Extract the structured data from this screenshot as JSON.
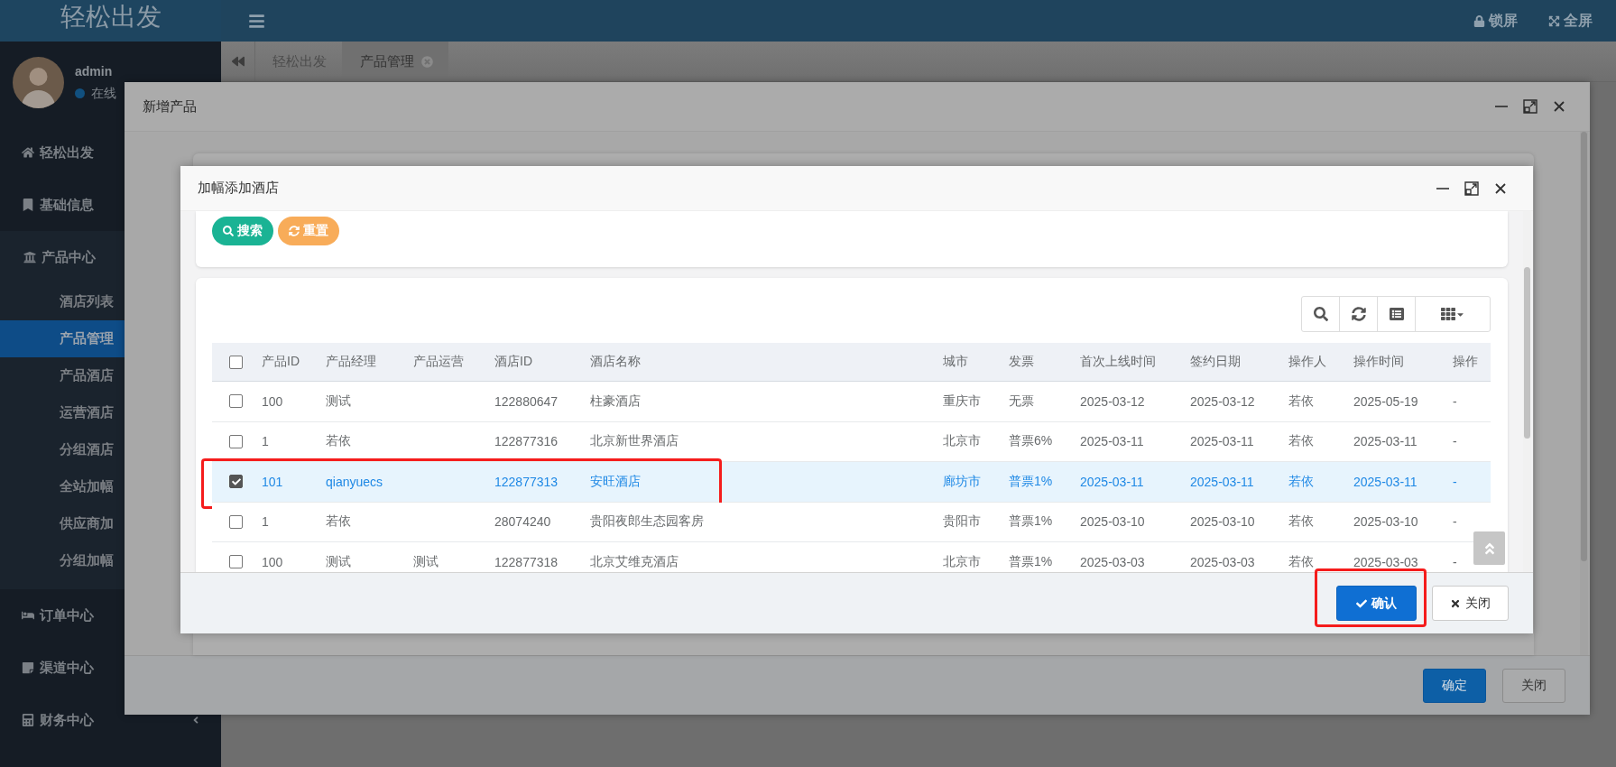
{
  "topbar": {
    "logo": "轻松出发",
    "actions": [
      {
        "kind": "lock",
        "label": "锁屏"
      },
      {
        "kind": "fullscreen",
        "label": "全屏"
      }
    ]
  },
  "user": {
    "name": "admin",
    "status": "在线"
  },
  "sidebar": {
    "items": [
      {
        "label": "轻松出发"
      },
      {
        "label": "基础信息"
      },
      {
        "label": "产品中心",
        "expanded": true,
        "children": [
          {
            "label": "酒店列表",
            "selected": false
          },
          {
            "label": "产品管理",
            "selected": true
          },
          {
            "label": "产品酒店",
            "selected": false
          },
          {
            "label": "运营酒店",
            "selected": false
          },
          {
            "label": "分组酒店",
            "selected": false
          },
          {
            "label": "全站加幅",
            "selected": false
          },
          {
            "label": "供应商加",
            "selected": false
          },
          {
            "label": "分组加幅",
            "selected": false
          }
        ]
      },
      {
        "label": "订单中心"
      },
      {
        "label": "渠道中心"
      },
      {
        "label": "财务中心",
        "expanded": false
      }
    ]
  },
  "tabs": [
    {
      "label": "轻松出发",
      "selected": false,
      "closable": false
    },
    {
      "label": "产品管理",
      "selected": true,
      "closable": true
    }
  ],
  "outer_dialog": {
    "title": "新增产品",
    "buttons": [
      {
        "kind": "primary",
        "label": "确定"
      },
      {
        "kind": "default",
        "label": "关闭"
      }
    ]
  },
  "inner_dialog": {
    "title": "加幅添加酒店",
    "search_buttons": [
      {
        "kind": "search",
        "label": "搜索"
      },
      {
        "kind": "reset",
        "label": "重置"
      }
    ],
    "toolbar": [
      {
        "kind": "search"
      },
      {
        "kind": "refresh"
      },
      {
        "kind": "list"
      },
      {
        "kind": "columns"
      }
    ],
    "table": {
      "all_checked": false,
      "columns": [
        "产品ID",
        "产品经理",
        "产品运营",
        "酒店ID",
        "酒店名称",
        "城市",
        "发票",
        "首次上线时间",
        "签约日期",
        "操作人",
        "操作时间",
        "操作"
      ],
      "rows": [
        {
          "selected": false,
          "highlighted": false,
          "cells": [
            "100",
            "测试",
            null,
            "122880647",
            "柱豪酒店",
            "重庆市",
            "无票",
            "2025-03-12",
            "2025-03-12",
            "若依",
            "2025-05-19",
            "-"
          ]
        },
        {
          "selected": false,
          "highlighted": false,
          "cells": [
            "1",
            "若依",
            null,
            "122877316",
            "北京新世界酒店",
            "北京市",
            "普票6%",
            "2025-03-11",
            "2025-03-11",
            "若依",
            "2025-03-11",
            "-"
          ]
        },
        {
          "selected": true,
          "highlighted": true,
          "cells": [
            "101",
            "qianyuecs",
            null,
            "122877313",
            "安旺酒店",
            "廊坊市",
            "普票1%",
            "2025-03-11",
            "2025-03-11",
            "若依",
            "2025-03-11",
            "-"
          ]
        },
        {
          "selected": false,
          "highlighted": false,
          "cells": [
            "1",
            "若依",
            null,
            "28074240",
            "贵阳夜郎生态园客房",
            "贵阳市",
            "普票1%",
            "2025-03-10",
            "2025-03-10",
            "若依",
            "2025-03-10",
            "-"
          ]
        },
        {
          "selected": false,
          "highlighted": false,
          "cells": [
            "100",
            "测试",
            "测试",
            "122877318",
            "北京艾维克酒店",
            "北京市",
            "普票1%",
            "2025-03-03",
            "2025-03-03",
            "若依",
            "2025-03-03",
            "-"
          ]
        }
      ]
    },
    "buttons": [
      {
        "kind": "confirm",
        "label": "确认",
        "highlighted": true
      },
      {
        "kind": "close",
        "label": "关闭",
        "highlighted": false
      }
    ]
  }
}
